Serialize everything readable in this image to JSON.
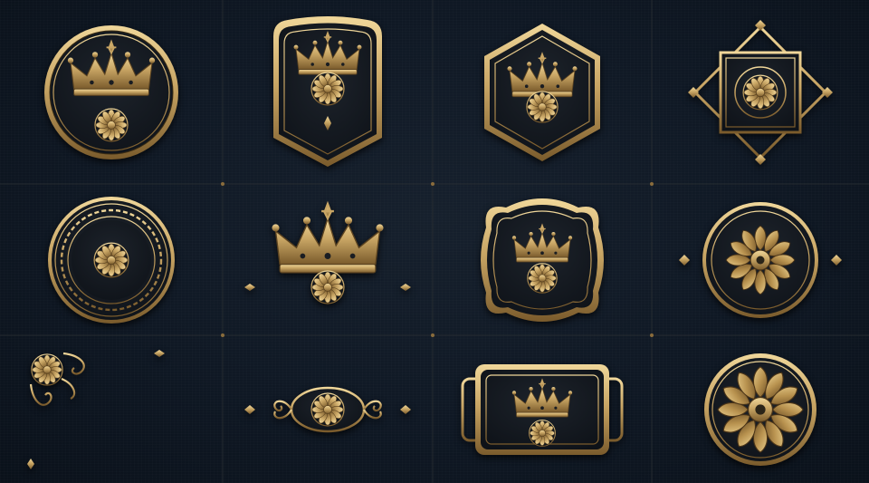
{
  "sheet": {
    "grid": {
      "columns": 4,
      "rows": 3
    },
    "colors": {
      "background": "#0f1824",
      "gold": "#c8a564",
      "gold_dark": "#7a5b2c",
      "gold_light": "#f0d79a",
      "emblem_fill": "#151a21"
    },
    "emblems": [
      {
        "name": "round-crown-badge-emblem",
        "icons": [
          "crown-icon",
          "rosette-icon"
        ]
      },
      {
        "name": "shield-crown-badge-emblem",
        "icons": [
          "crown-icon",
          "rosette-icon",
          "diamond-icon"
        ]
      },
      {
        "name": "hexagon-crown-badge-emblem",
        "icons": [
          "crown-icon",
          "rosette-icon"
        ]
      },
      {
        "name": "diamond-frame-rosette-emblem",
        "icons": [
          "rosette-icon"
        ]
      },
      {
        "name": "greek-key-circle-emblem",
        "icons": [
          "greek-key-border",
          "rosette-icon"
        ]
      },
      {
        "name": "crown-divider-emblem",
        "icons": [
          "crown-icon",
          "rosette-icon"
        ]
      },
      {
        "name": "quatrefoil-crown-badge-emblem",
        "icons": [
          "crown-icon",
          "rosette-icon"
        ]
      },
      {
        "name": "ring-large-rosette-emblem",
        "icons": [
          "rosette-icon"
        ]
      },
      {
        "name": "ornate-corner-bracket-emblem",
        "icons": [
          "scroll-icon",
          "rosette-icon"
        ]
      },
      {
        "name": "scroll-divider-emblem",
        "icons": [
          "scroll-icon",
          "rosette-icon"
        ]
      },
      {
        "name": "rectangular-crown-plaque-emblem",
        "icons": [
          "crown-icon",
          "rosette-icon"
        ]
      },
      {
        "name": "round-medallion-rosette-emblem",
        "icons": [
          "rosette-icon"
        ]
      }
    ]
  }
}
